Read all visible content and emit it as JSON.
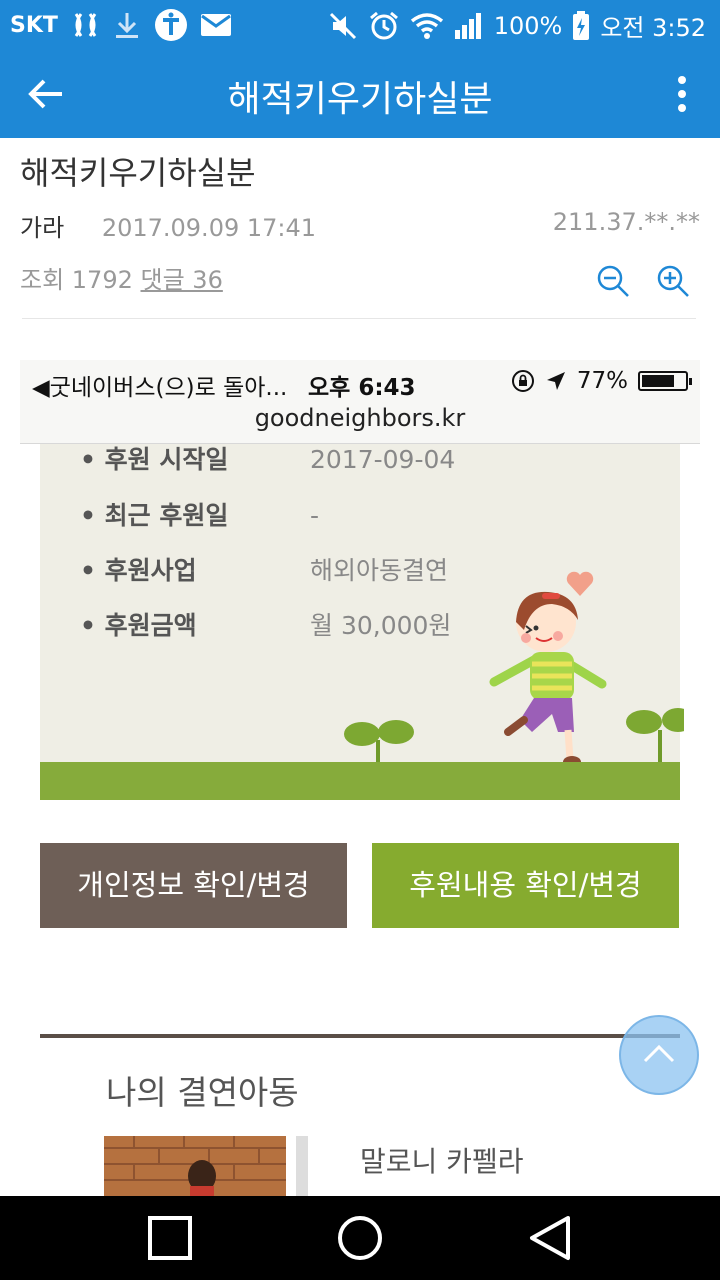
{
  "status_bar": {
    "carrier": "SKT",
    "battery": "100%",
    "time": "오전 3:52",
    "icons": [
      "signal-wave-icon",
      "download-icon",
      "t-app-icon",
      "mail-icon",
      "mute-icon",
      "alarm-icon",
      "wifi-icon",
      "cell-signal-icon",
      "battery-charging-icon"
    ]
  },
  "app_bar": {
    "title": "해적키우기하실분",
    "back_icon": "arrow-left-icon",
    "more_icon": "more-vert-icon",
    "color": "#1e88d6"
  },
  "post": {
    "title": "해적키우기하실분",
    "author": "가라",
    "datetime": "2017.09.09 17:41",
    "ip": "211.37.**.**",
    "views_text": "조회 1792",
    "comments_text": "댓글 36"
  },
  "embedded": {
    "ios_status": {
      "back_text": "◀굿네이버스(으)로 돌아...",
      "time": "오후 6:43",
      "battery": "77%",
      "battery_level": 0.77
    },
    "url": "goodneighbors.kr",
    "info_rows": [
      {
        "label": "• 후원 시작일",
        "value": "2017-09-04"
      },
      {
        "label": "• 최근 후원일",
        "value": "-"
      },
      {
        "label": "• 후원사업",
        "value": "해외아동결연"
      },
      {
        "label": "• 후원금액",
        "value": "월 30,000원"
      }
    ],
    "buttons": {
      "personal_info": "개인정보 확인/변경",
      "support_content": "후원내용 확인/변경"
    },
    "section_title": "나의 결연아동",
    "child_name": "말로니 카펠라",
    "colors": {
      "beige": "#efeee5",
      "green": "#86ab2f",
      "brown": "#6e5f57"
    }
  },
  "scroll_top_icon": "chevron-up-icon",
  "nav_bar": {
    "icons": [
      "recents-square-icon",
      "home-circle-icon",
      "back-triangle-icon"
    ]
  }
}
